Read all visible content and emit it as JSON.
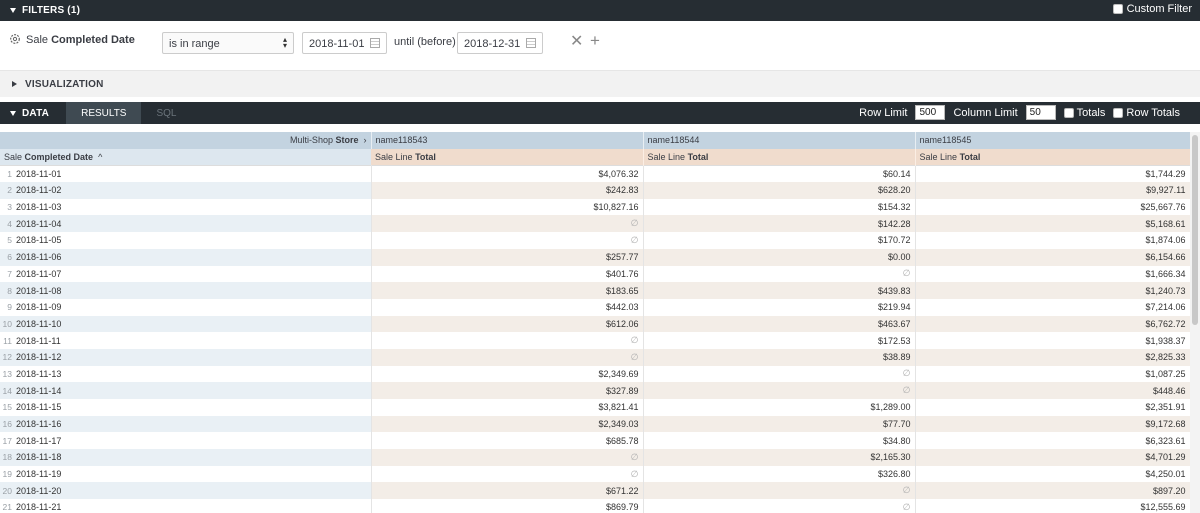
{
  "filters": {
    "title": "FILTERS (1)",
    "custom_filter_label": "Custom Filter",
    "field_plain": "Sale",
    "field_bold": "Completed Date",
    "operator": "is in range",
    "start_date": "2018-11-01",
    "until_label": "until (before)",
    "end_date": "2018-12-31"
  },
  "visualization": {
    "title": "VISUALIZATION"
  },
  "data_bar": {
    "title": "DATA",
    "tab_results": "RESULTS",
    "tab_sql": "SQL",
    "row_limit_label": "Row Limit",
    "row_limit_value": "500",
    "column_limit_label": "Column Limit",
    "column_limit_value": "50",
    "totals_label": "Totals",
    "row_totals_label": "Row Totals"
  },
  "grid": {
    "pivot_label_plain": "Multi-Shop",
    "pivot_label_bold": "Store",
    "pivot_columns": [
      "name118543",
      "name118544",
      "name118545"
    ],
    "dimension_plain": "Sale",
    "dimension_bold": "Completed Date",
    "measure_plain": "Sale Line",
    "measure_bold": "Total",
    "null_symbol": "∅",
    "rows": [
      {
        "n": "1",
        "date": "2018-11-01",
        "v": [
          "$4,076.32",
          "$60.14",
          "$1,744.29"
        ]
      },
      {
        "n": "2",
        "date": "2018-11-02",
        "v": [
          "$242.83",
          "$628.20",
          "$9,927.11"
        ]
      },
      {
        "n": "3",
        "date": "2018-11-03",
        "v": [
          "$10,827.16",
          "$154.32",
          "$25,667.76"
        ]
      },
      {
        "n": "4",
        "date": "2018-11-04",
        "v": [
          null,
          "$142.28",
          "$5,168.61"
        ]
      },
      {
        "n": "5",
        "date": "2018-11-05",
        "v": [
          null,
          "$170.72",
          "$1,874.06"
        ]
      },
      {
        "n": "6",
        "date": "2018-11-06",
        "v": [
          "$257.77",
          "$0.00",
          "$6,154.66"
        ]
      },
      {
        "n": "7",
        "date": "2018-11-07",
        "v": [
          "$401.76",
          null,
          "$1,666.34"
        ]
      },
      {
        "n": "8",
        "date": "2018-11-08",
        "v": [
          "$183.65",
          "$439.83",
          "$1,240.73"
        ]
      },
      {
        "n": "9",
        "date": "2018-11-09",
        "v": [
          "$442.03",
          "$219.94",
          "$7,214.06"
        ]
      },
      {
        "n": "10",
        "date": "2018-11-10",
        "v": [
          "$612.06",
          "$463.67",
          "$6,762.72"
        ]
      },
      {
        "n": "11",
        "date": "2018-11-11",
        "v": [
          null,
          "$172.53",
          "$1,938.37"
        ]
      },
      {
        "n": "12",
        "date": "2018-11-12",
        "v": [
          null,
          "$38.89",
          "$2,825.33"
        ]
      },
      {
        "n": "13",
        "date": "2018-11-13",
        "v": [
          "$2,349.69",
          null,
          "$1,087.25"
        ]
      },
      {
        "n": "14",
        "date": "2018-11-14",
        "v": [
          "$327.89",
          null,
          "$448.46"
        ]
      },
      {
        "n": "15",
        "date": "2018-11-15",
        "v": [
          "$3,821.41",
          "$1,289.00",
          "$2,351.91"
        ]
      },
      {
        "n": "16",
        "date": "2018-11-16",
        "v": [
          "$2,349.03",
          "$77.70",
          "$9,172.68"
        ]
      },
      {
        "n": "17",
        "date": "2018-11-17",
        "v": [
          "$685.78",
          "$34.80",
          "$6,323.61"
        ]
      },
      {
        "n": "18",
        "date": "2018-11-18",
        "v": [
          null,
          "$2,165.30",
          "$4,701.29"
        ]
      },
      {
        "n": "19",
        "date": "2018-11-19",
        "v": [
          null,
          "$326.80",
          "$4,250.01"
        ]
      },
      {
        "n": "20",
        "date": "2018-11-20",
        "v": [
          "$671.22",
          null,
          "$897.20"
        ]
      },
      {
        "n": "21",
        "date": "2018-11-21",
        "v": [
          "$869.79",
          null,
          "$12,555.69"
        ]
      }
    ]
  },
  "colors": {
    "top_bar": "#262d33",
    "pivot_header": "#c3d3e0",
    "dimension_header": "#dde7ef",
    "measure_header": "#f0dccd"
  }
}
